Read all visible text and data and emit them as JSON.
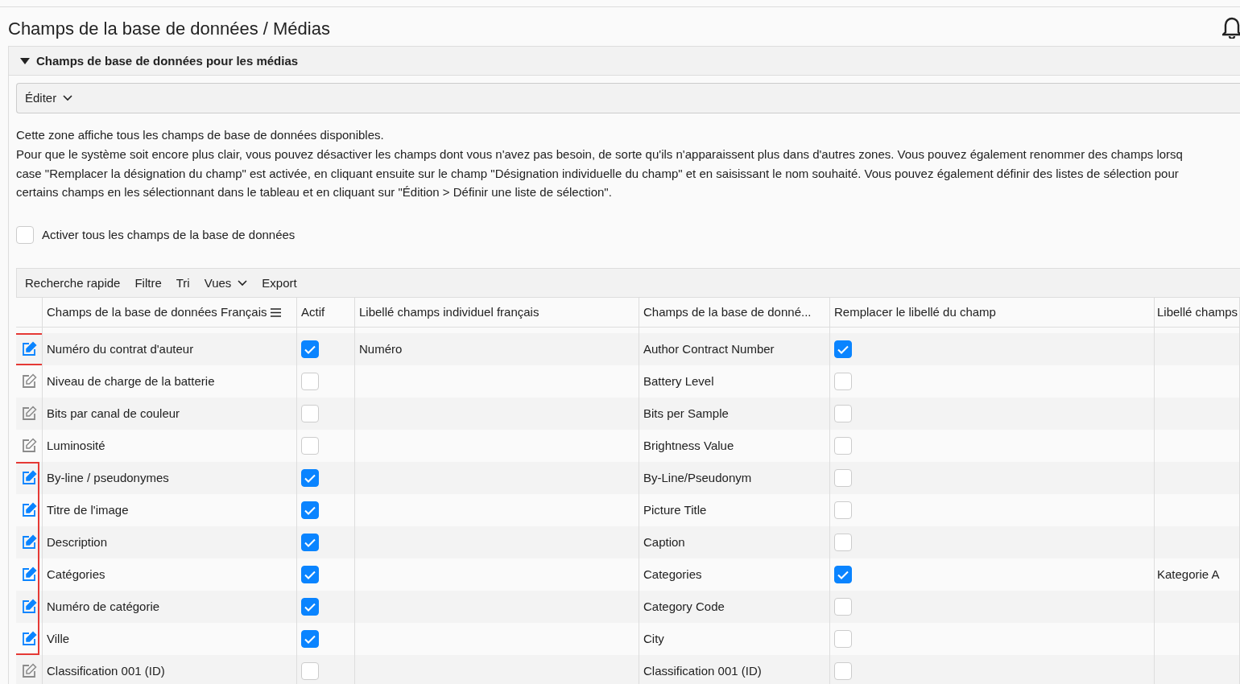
{
  "page": {
    "title": "Champs de la base de données / Médias"
  },
  "section": {
    "title": "Champs de base de données pour les médias",
    "expanded": true
  },
  "edit_menu": {
    "label": "Éditer"
  },
  "intro": [
    "Cette zone affiche tous les champs de base de données disponibles.",
    "Pour que le système soit encore plus clair, vous pouvez désactiver les champs dont vous n'avez pas besoin, de sorte qu'ils n'apparaissent plus dans d'autres zones. Vous pouvez également renommer des champs lorsq",
    "case \"Remplacer la désignation du champ\" est activée, en cliquant ensuite sur le champ \"Désignation individuelle du champ\" et en saisissant le nom souhaité. Vous pouvez également définir des listes de sélection pour",
    "certains champs en les sélectionnant dans le tableau et en cliquant sur \"Édition > Définir une liste de sélection\"."
  ],
  "activate_all": {
    "label": "Activer tous les champs de la base de données",
    "checked": false
  },
  "toolbar": [
    {
      "label": "Recherche rapide",
      "kind": "plain"
    },
    {
      "label": "Filtre",
      "kind": "plain"
    },
    {
      "label": "Tri",
      "kind": "plain"
    },
    {
      "label": "Vues",
      "kind": "dropdown"
    },
    {
      "label": "Export",
      "kind": "plain"
    }
  ],
  "table": {
    "columns": [
      "Champs de la base de données Français",
      "Actif",
      "Libellé champs individuel français",
      "Champs de la base de donné...",
      "Remplacer le libellé du champ",
      "Libellé champs"
    ],
    "rows": [
      {
        "name": "Numéro du contrat d'auteur",
        "active": true,
        "label_fr": "Numéro",
        "field": "Author Contract Number",
        "replace": true,
        "label": "",
        "highlighted": true
      },
      {
        "name": "Niveau de charge de la batterie",
        "active": false,
        "label_fr": "",
        "field": "Battery Level",
        "replace": false,
        "label": "",
        "highlighted": false
      },
      {
        "name": "Bits par canal de couleur",
        "active": false,
        "label_fr": "",
        "field": "Bits per Sample",
        "replace": false,
        "label": "",
        "highlighted": false
      },
      {
        "name": "Luminosité",
        "active": false,
        "label_fr": "",
        "field": "Brightness Value",
        "replace": false,
        "label": "",
        "highlighted": false
      },
      {
        "name": "By-line / pseudonymes",
        "active": true,
        "label_fr": "",
        "field": "By-Line/Pseudonym",
        "replace": false,
        "label": "",
        "highlighted": true
      },
      {
        "name": "Titre de l'image",
        "active": true,
        "label_fr": "",
        "field": "Picture Title",
        "replace": false,
        "label": "",
        "highlighted": true
      },
      {
        "name": "Description",
        "active": true,
        "label_fr": "",
        "field": "Caption",
        "replace": false,
        "label": "",
        "highlighted": true
      },
      {
        "name": "Catégories",
        "active": true,
        "label_fr": "",
        "field": "Categories",
        "replace": true,
        "label": "Kategorie A",
        "highlighted": true
      },
      {
        "name": "Numéro de catégorie",
        "active": true,
        "label_fr": "",
        "field": "Category Code",
        "replace": false,
        "label": "",
        "highlighted": true
      },
      {
        "name": "Ville",
        "active": true,
        "label_fr": "",
        "field": "City",
        "replace": false,
        "label": "",
        "highlighted": true
      },
      {
        "name": "Classification 001 (ID)",
        "active": false,
        "label_fr": "",
        "field": "Classification 001 (ID)",
        "replace": false,
        "label": "",
        "highlighted": false
      }
    ]
  }
}
